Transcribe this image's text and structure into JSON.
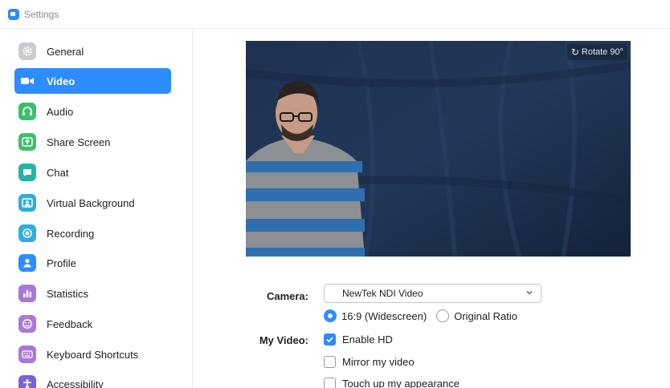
{
  "window": {
    "title": "Settings"
  },
  "sidebar": {
    "items": [
      {
        "label": "General",
        "icon": "gear-icon",
        "color": "#c9ccd1",
        "active": false
      },
      {
        "label": "Video",
        "icon": "video-camera-icon",
        "color": "#2d8cff",
        "active": true
      },
      {
        "label": "Audio",
        "icon": "headphones-icon",
        "color": "#3dbf6b",
        "active": false
      },
      {
        "label": "Share Screen",
        "icon": "share-screen-icon",
        "color": "#3dbf6b",
        "active": false
      },
      {
        "label": "Chat",
        "icon": "chat-bubble-icon",
        "color": "#25b3a3",
        "active": false
      },
      {
        "label": "Virtual Background",
        "icon": "person-frame-icon",
        "color": "#2eaee0",
        "active": false
      },
      {
        "label": "Recording",
        "icon": "record-icon",
        "color": "#2eaee0",
        "active": false
      },
      {
        "label": "Profile",
        "icon": "person-icon",
        "color": "#2d8cff",
        "active": false
      },
      {
        "label": "Statistics",
        "icon": "bar-chart-icon",
        "color": "#a779d8",
        "active": false
      },
      {
        "label": "Feedback",
        "icon": "smiley-icon",
        "color": "#a779d8",
        "active": false
      },
      {
        "label": "Keyboard Shortcuts",
        "icon": "keyboard-icon",
        "color": "#a779d8",
        "active": false
      },
      {
        "label": "Accessibility",
        "icon": "accessibility-icon",
        "color": "#7b62d6",
        "active": false
      }
    ]
  },
  "video": {
    "rotate_label": "Rotate 90°"
  },
  "settings": {
    "camera_label": "Camera:",
    "camera_value": "NewTek NDI Video",
    "my_video_label": "My Video:",
    "aspect_options": [
      {
        "label": "16:9 (Widescreen)",
        "selected": true
      },
      {
        "label": "Original Ratio",
        "selected": false
      }
    ],
    "checkboxes": [
      {
        "label": "Enable HD",
        "checked": true
      },
      {
        "label": "Mirror my video",
        "checked": false
      },
      {
        "label": "Touch up my appearance",
        "checked": false
      }
    ]
  },
  "colors": {
    "accent": "#2d8cff",
    "preview_background": "#1a2b48"
  }
}
